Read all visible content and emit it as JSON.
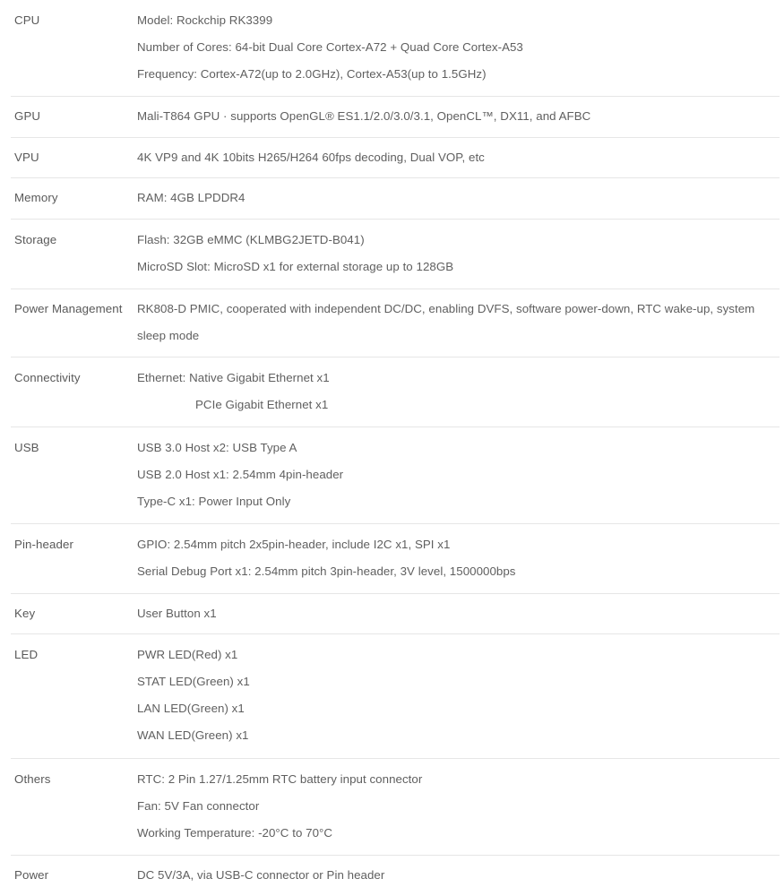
{
  "table": {
    "rows": [
      {
        "label": "CPU",
        "lines": [
          {
            "text": "Model: Rockchip RK3399",
            "indent": false
          },
          {
            "text": "Number of Cores: 64-bit Dual Core Cortex-A72 + Quad Core Cortex-A53",
            "indent": false
          },
          {
            "text": "Frequency: Cortex-A72(up to 2.0GHz), Cortex-A53(up to 1.5GHz)",
            "indent": false
          }
        ]
      },
      {
        "label": "GPU",
        "lines": [
          {
            "text": "Mali-T864 GPU  ·  supports OpenGL® ES1.1/2.0/3.0/3.1, OpenCL™, DX11, and AFBC",
            "indent": false
          }
        ]
      },
      {
        "label": "VPU",
        "lines": [
          {
            "text": "4K VP9 and 4K 10bits H265/H264 60fps decoding, Dual VOP, etc",
            "indent": false
          }
        ]
      },
      {
        "label": "Memory",
        "lines": [
          {
            "text": "RAM: 4GB LPDDR4",
            "indent": false
          }
        ]
      },
      {
        "label": "Storage",
        "lines": [
          {
            "text": "Flash: 32GB eMMC (KLMBG2JETD-B041)",
            "indent": false
          },
          {
            "text": "MicroSD Slot: MicroSD x1 for external storage up to 128GB",
            "indent": false
          }
        ]
      },
      {
        "label": "Power Management",
        "lines": [
          {
            "text": "RK808-D PMIC, cooperated with independent DC/DC, enabling DVFS, software power-down, RTC wake-up, system sleep mode",
            "indent": false
          }
        ]
      },
      {
        "label": "Connectivity",
        "lines": [
          {
            "text": "Ethernet: Native Gigabit Ethernet x1",
            "indent": false
          },
          {
            "text": "PCIe Gigabit Ethernet x1",
            "indent": true
          }
        ]
      },
      {
        "label": "USB",
        "lines": [
          {
            "text": "USB 3.0 Host x2: USB Type A",
            "indent": false
          },
          {
            "text": "USB 2.0 Host x1: 2.54mm 4pin-header",
            "indent": false
          },
          {
            "text": "Type-C x1: Power Input Only",
            "indent": false
          }
        ]
      },
      {
        "label": "Pin-header",
        "lines": [
          {
            "text": "GPIO: 2.54mm pitch 2x5pin-header, include I2C x1, SPI x1",
            "indent": false
          },
          {
            "text": "Serial Debug Port x1: 2.54mm pitch 3pin-header, 3V level, 1500000bps",
            "indent": false
          }
        ]
      },
      {
        "label": "Key",
        "lines": [
          {
            "text": "User Button x1",
            "indent": false
          }
        ]
      },
      {
        "label": "LED",
        "lines": [
          {
            "text": "PWR LED(Red) x1",
            "indent": false
          },
          {
            "text": "STAT LED(Green) x1",
            "indent": false
          },
          {
            "text": "LAN LED(Green) x1",
            "indent": false
          },
          {
            "text": "WAN LED(Green) x1",
            "indent": false
          }
        ]
      },
      {
        "label": "Others",
        "lines": [
          {
            "text": "RTC: 2 Pin 1.27/1.25mm RTC battery input connector",
            "indent": false
          },
          {
            "text": "Fan: 5V Fan connector",
            "indent": false
          },
          {
            "text": "Working Temperature: -20°C to 70°C",
            "indent": false
          }
        ]
      },
      {
        "label": "Power",
        "lines": [
          {
            "text": "DC 5V/3A, via USB-C connector or Pin header",
            "indent": false
          }
        ]
      }
    ]
  },
  "colors": {
    "text": "#5a5a5a",
    "label": "#595959",
    "rule": "#e6e6e6",
    "background": "#ffffff"
  }
}
